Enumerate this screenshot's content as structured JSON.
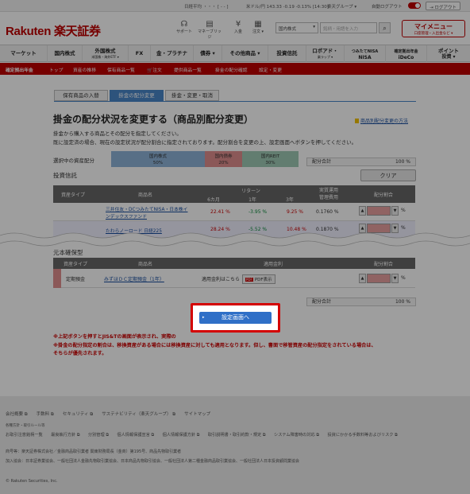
{
  "topbar": {
    "nikkei": "日経平均 ・・・ [ - - ]",
    "usd": "米ドル/円 143.33 -0.19 -0.13% [14:30]",
    "group": "楽天グループ ▾",
    "auto_logout": "自動ログアウト",
    "logout": "ログアウト"
  },
  "header": {
    "logo": "Rakuten 楽天証券",
    "icons": [
      {
        "icon": "headset-icon",
        "label": "サポート"
      },
      {
        "icon": "book-icon",
        "label": "マネーブリッジ"
      },
      {
        "icon": "deposit-icon",
        "label": "入金"
      },
      {
        "icon": "order-icon",
        "label": "注文 ▾"
      }
    ],
    "search_select": "国内株式",
    "search_placeholder": "銘柄・用語を入力",
    "mymenu": "マイメニュー",
    "mymenu_sub": "口座管理・入出金など ▾"
  },
  "nav": [
    {
      "label": "マーケット"
    },
    {
      "label": "国内株式"
    },
    {
      "label": "外国株式",
      "sub": "米国株・海外ETF ▾"
    },
    {
      "label": "FX"
    },
    {
      "label": "金・プラチナ"
    },
    {
      "label": "債券 ▾"
    },
    {
      "label": "その他商品 ▾"
    },
    {
      "label": "投資信託"
    },
    {
      "label": "ロボアド・",
      "sub": "楽ラップ ▾"
    },
    {
      "label": "つみたてNISA",
      "sub": "NISA"
    },
    {
      "label": "確定拠出年金",
      "sub": "iDeCo"
    },
    {
      "label": "ポイント",
      "sub": "投資 ▾"
    }
  ],
  "subnav": [
    "確定拠出年金",
    "トップ",
    "資産の推移",
    "保有商品一覧",
    "注文",
    "提供商品一覧",
    "掛金の配分確認",
    "設定・変更"
  ],
  "tabs": [
    "保有商品の入替",
    "掛金の配分変更",
    "掛金・変更・取消"
  ],
  "page_title": "掛金の配分状況を変更する（商品別配分変更）",
  "help_link": "商品別配分変更の方法",
  "desc1": "掛金から購入する商品とその配分を指定してください。",
  "desc2": "既に設定済の場合、現在の設定状況が配分割合に指定されております。配分割合を変更の上、設定画面へボタンを押してください。",
  "allocation": {
    "label": "選択中の資産配分",
    "segments": [
      {
        "name": "国内株式",
        "pct": "50%",
        "color": "#8fb4d9"
      },
      {
        "name": "国内債券",
        "pct": "20%",
        "color": "#e08f8f"
      },
      {
        "name": "国内REIT",
        "pct": "30%",
        "color": "#9fcab5"
      }
    ]
  },
  "sum_label": "配分合計",
  "sum_value": "100 %",
  "section_fund": "投資信託",
  "clear_button": "クリア",
  "fund_table": {
    "headers": {
      "type": "資産タイプ",
      "name": "商品名",
      "return": "リターン",
      "m6": "6カ月",
      "y1": "1年",
      "y3": "3年",
      "cost": "実質運用\n管理費用",
      "ratio": "配分割合"
    },
    "rows": [
      {
        "name1": "三井住友・DCつみたてNISA・日本株イ",
        "name2": "ンデックスファンド",
        "m6": "22.41 %",
        "y1": "-3.95 %",
        "y3": "9.25 %",
        "cost": "0.1760 %",
        "unit": "%"
      },
      {
        "name1": "たわらノーロード 日経225",
        "name2": "",
        "m6": "28.24 %",
        "y1": "-5.52 %",
        "y3": "10.48 %",
        "cost": "0.1870 %",
        "unit": "%"
      }
    ]
  },
  "section_principal": "元本確保型",
  "principal_table": {
    "headers": {
      "type": "資産タイプ",
      "name": "商品名",
      "rate": "適用金利",
      "ratio": "配分割合"
    },
    "row": {
      "type": "定期預金",
      "name": "みずほＤＣ定期預金（1年）",
      "rate": "適用金利はこちら",
      "pdf": "PDF表示",
      "unit": "%"
    }
  },
  "sum2_label": "配分合計",
  "sum2_value": "100 %",
  "cta": "設定画面へ",
  "notes": [
    "※上記ボタンを押すとJIS&Tの画面が表示され、実際の",
    "※掛金の配分指定の割合は、移換資産がある場合には移換資産に対しても適用となります。但し、書面で移管資産の配分指定をされている場合は、",
    "そちらが優先されます。"
  ],
  "footer": {
    "links1": "会社概要 ⧉　　手数料 ⧉　　セキュリティ ⧉　　サステナビリティ（楽天グループ） ⧉　　サイトマップ",
    "policy_head": "各種方針・取引ルール等",
    "links2": "お取引注意銘柄一覧　　最良執行方針 ⧉　　分別管理 ⧉　　個人情報保護宣言 ⧉　　個人情報保護方針 ⧉　　取引説明書・取引約款・規定 ⧉　　システム障害時の対応 ⧉　　投資にかかる手数料等およびリスク ⧉",
    "company": "商号等：楽天証券株式会社／金融商品取引業者 関東財務局長（金商）第195号、商品先物取引業者",
    "assoc": "加入協会：日本証券業協会、一般社団法人金融先物取引業協会、日本商品先物取引協会、一般社団法人第二種金融商品取引業協会、一般社団法人日本投資顧問業協会",
    "copyright": "© Rakuten Securities, Inc."
  }
}
